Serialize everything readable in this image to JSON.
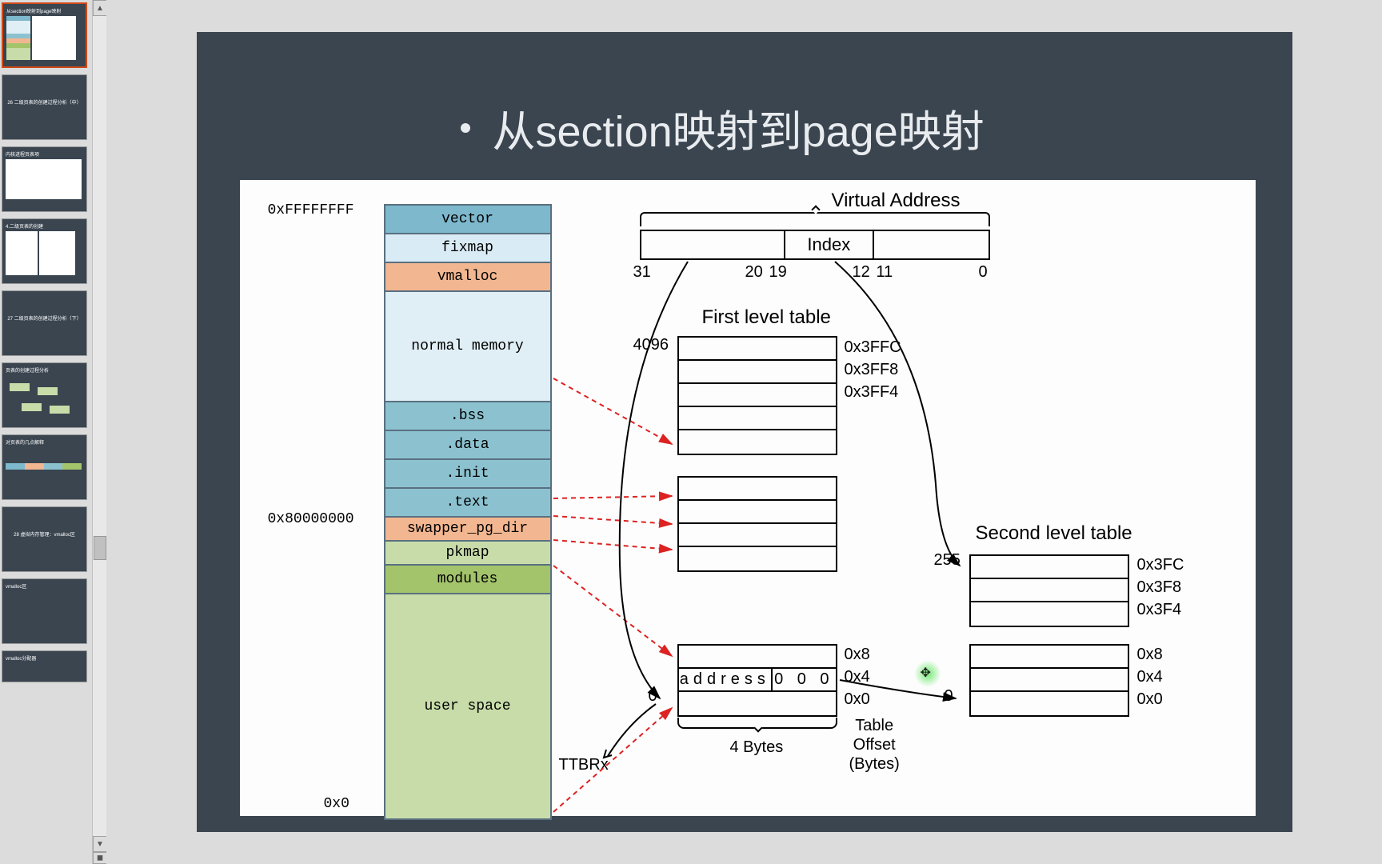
{
  "title": "从section映射到page映射",
  "thumbnails": [
    {
      "label": "从section映射到page映射",
      "selected": true
    },
    {
      "label": "26 二级页表的创建过程分析（中）"
    },
    {
      "label": "内核进程页表项"
    },
    {
      "label": "4.二级页表的创建"
    },
    {
      "label": "27 二级页表的创建过程分析（下）"
    },
    {
      "label": "页表的创建过程分析"
    },
    {
      "label": "对页表的几点解释"
    },
    {
      "label": "28 虚拟内存管理：vmalloc区"
    },
    {
      "label": "vmalloc区"
    },
    {
      "label": "vmalloc分配器"
    }
  ],
  "memory": {
    "top_addr": "0xFFFFFFFF",
    "mid_addr": "0x80000000",
    "bot_addr": "0x0",
    "segs": [
      "vector",
      "fixmap",
      "vmalloc",
      "normal memory",
      ".bss",
      ".data",
      ".init",
      ".text",
      "swapper_pg_dir",
      "pkmap",
      "modules",
      "user space"
    ]
  },
  "va": {
    "title": "Virtual Address",
    "index_label": "Index",
    "bits": {
      "b31": "31",
      "b20": "20",
      "b19": "19",
      "b12": "12",
      "b11": "11",
      "b0": "0"
    }
  },
  "flt": {
    "title": "First level table",
    "top_count": "4096",
    "offsets_top": [
      "0x3FFC",
      "0x3FF8",
      "0x3FF4"
    ],
    "offsets_bot": [
      "0x8",
      "0x4",
      "0x0"
    ],
    "addr_label": "address",
    "zeros": "0 0 0",
    "zero_idx": "0",
    "width_label": "4 Bytes",
    "table_offset_label": "Table\nOffset\n(Bytes)",
    "ttbr": "TTBRx"
  },
  "slt": {
    "title": "Second level table",
    "top_count": "255",
    "offsets_top": [
      "0x3FC",
      "0x3F8",
      "0x3F4"
    ],
    "offsets_bot": [
      "0x8",
      "0x4",
      "0x0"
    ],
    "zero_idx": "0"
  }
}
